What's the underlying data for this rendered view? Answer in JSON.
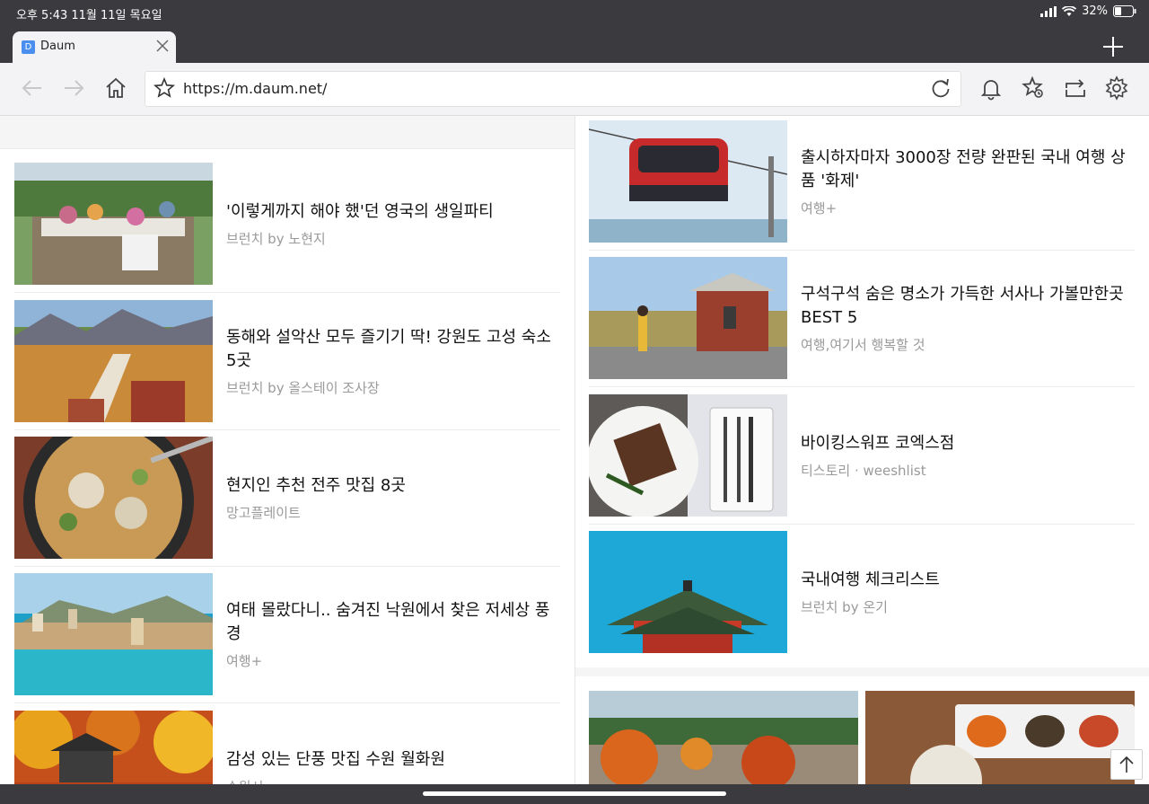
{
  "status": {
    "time": "오후 5:43   11월 11일 목요일",
    "battery": "32%"
  },
  "tab": {
    "favicon": "D",
    "title": "Daum"
  },
  "toolbar": {
    "url": "https://m.daum.net/"
  },
  "left_articles": [
    {
      "title": "'이렇게까지 해야 했'던 영국의 생일파티",
      "meta": "브런치 by 노현지"
    },
    {
      "title": "동해와 설악산 모두 즐기기 딱! 강원도 고성 숙소 5곳",
      "meta": "브런치 by 올스테이 조사장"
    },
    {
      "title": "현지인 추천 전주 맛집 8곳",
      "meta": "망고플레이트"
    },
    {
      "title": "여태 몰랐다니.. 숨겨진 낙원에서 찾은 저세상 풍경",
      "meta": "여행+"
    },
    {
      "title": "감성 있는 단풍 맛집 수원 월화원",
      "meta": "수원시"
    }
  ],
  "right_articles": [
    {
      "title": "출시하자마자 3000장 전량 완판된 국내 여행 상품 '화제'",
      "meta": "여행+"
    },
    {
      "title": "구석구석 숨은 명소가 가득한 서사나 가볼만한곳 BEST 5",
      "meta": "여행,여기서 행복할 것"
    },
    {
      "title": "바이킹스워프 코엑스점",
      "meta": "티스토리 · weeshlist"
    },
    {
      "title": "국내여행 체크리스트",
      "meta": "브런치 by 온기"
    }
  ],
  "colors": {
    "chrome_dark": "#3b3b3f",
    "toolbar_bg": "#f3f3f5",
    "favicon_blue": "#4a8ff0",
    "meta_gray": "#9a9a9a"
  }
}
